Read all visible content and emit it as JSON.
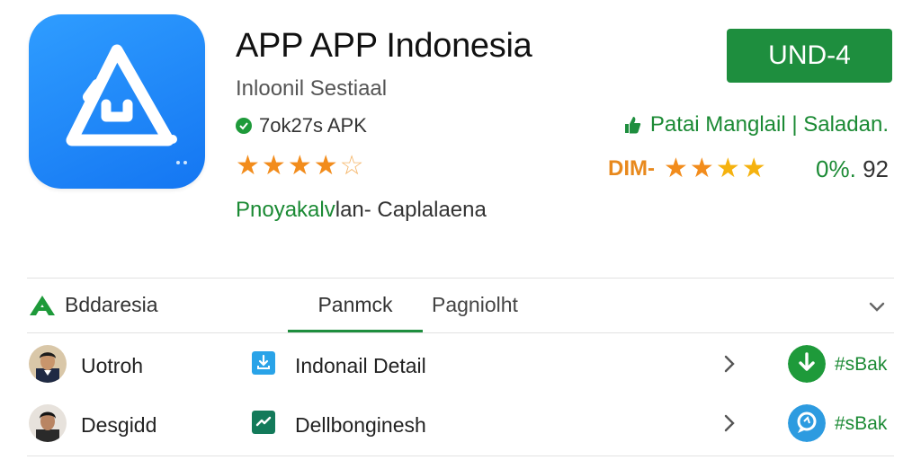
{
  "app": {
    "title": "APP APP Indonesia",
    "developer": "Inloonil Sestiaal",
    "size_label": "7ok27s APK",
    "tagline_green": "Pnoyakalv",
    "tagline_rest": "lan- Caplalaena",
    "rating_stars": 4,
    "icon_name": "warning-triangle-icon"
  },
  "install": {
    "label": "UND-4"
  },
  "info": {
    "text": "Patai Manglail | Saladan."
  },
  "stats": {
    "left": "DIM-",
    "stars": 4,
    "percent": "0%.",
    "count": "92"
  },
  "tabs": {
    "brand": "Bddaresia",
    "items": [
      {
        "label": "Panmck"
      },
      {
        "label": "Pagniolht"
      }
    ]
  },
  "list": [
    {
      "name": "Uotroh",
      "app": "Indonail Detail",
      "action": "#sBak",
      "action_icon": "download-icon",
      "action_color": "#1e9a3a"
    },
    {
      "name": "Desgidd",
      "app": "Dellbonginesh",
      "action": "#sBak",
      "action_icon": "location-icon",
      "action_color": "#2d9be0"
    }
  ],
  "colors": {
    "accent": "#1e8e3e",
    "star": "#f28c1c",
    "icon_blue": "#1f85f7"
  }
}
